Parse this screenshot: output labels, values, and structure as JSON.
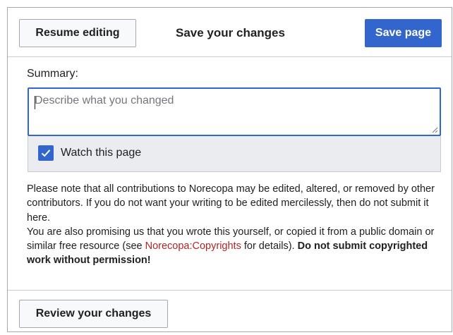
{
  "dialog": {
    "resume_label": "Resume editing",
    "title": "Save your changes",
    "save_label": "Save page"
  },
  "summary": {
    "label": "Summary:",
    "placeholder": "Describe what you changed",
    "value": ""
  },
  "watch": {
    "label": "Watch this page",
    "checked": true,
    "icon": "checkmark-icon"
  },
  "notice": {
    "line1": "Please note that all contributions to Norecopa may be edited, altered, or removed by other contributors. If you do not want your writing to be edited mercilessly, then do not submit it here.",
    "line2_before": "You are also promising us that you wrote this yourself, or copied it from a public domain or similar free resource (see ",
    "link": "Norecopa:Copyrights",
    "line2_after": " for details). ",
    "warning": "Do not submit copyrighted work without permission!"
  },
  "footer": {
    "review_label": "Review your changes"
  },
  "colors": {
    "accent": "#3366cc",
    "link": "#b32424",
    "border": "#a2a9b1"
  }
}
